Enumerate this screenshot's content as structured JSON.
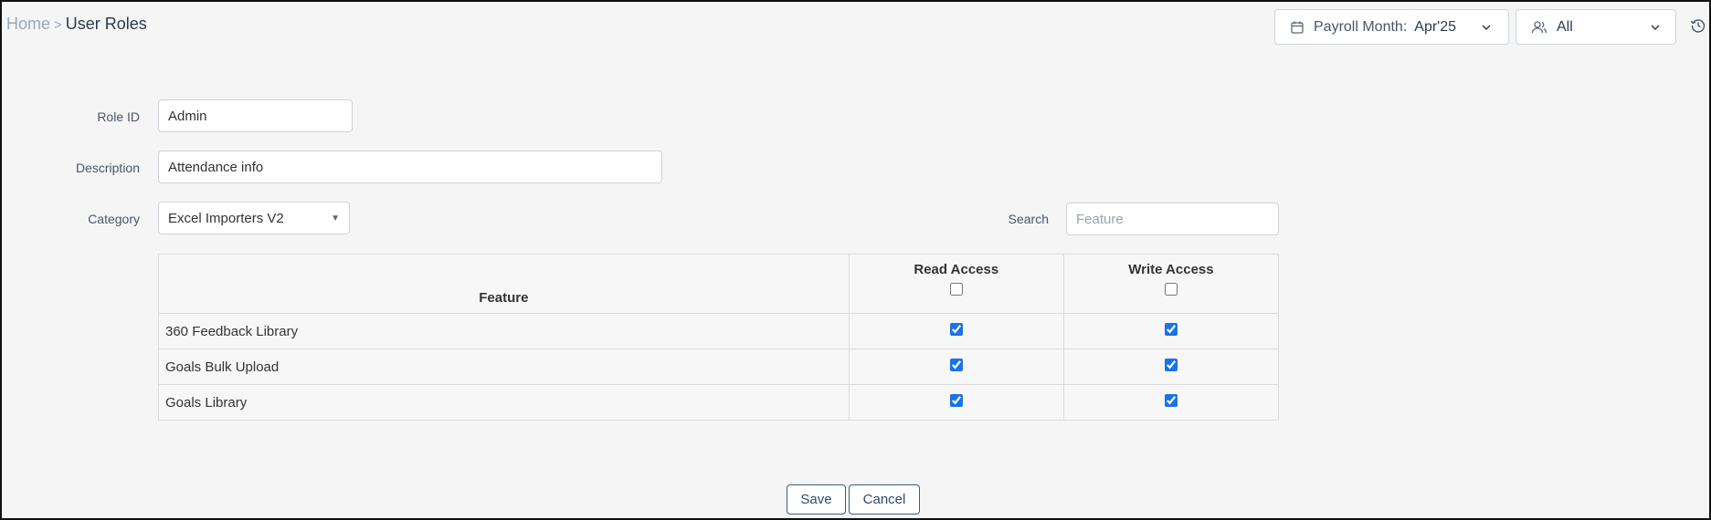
{
  "breadcrumb": {
    "home": "Home",
    "separator": ">",
    "current": "User Roles"
  },
  "header": {
    "payroll_label": "Payroll Month:",
    "payroll_value": "Apr'25",
    "people_value": "All"
  },
  "form": {
    "role_id_label": "Role ID",
    "role_id_value": "Admin",
    "description_label": "Description",
    "description_value": "Attendance info",
    "category_label": "Category",
    "category_value": "Excel Importers V2",
    "search_label": "Search",
    "search_placeholder": "Feature"
  },
  "table": {
    "headers": {
      "feature": "Feature",
      "read": "Read Access",
      "write": "Write Access"
    },
    "header_read_checked": false,
    "header_write_checked": false,
    "rows": [
      {
        "feature": "360 Feedback Library",
        "read": true,
        "write": true
      },
      {
        "feature": "Goals Bulk Upload",
        "read": true,
        "write": true
      },
      {
        "feature": "Goals Library",
        "read": true,
        "write": true
      }
    ]
  },
  "buttons": {
    "save": "Save",
    "cancel": "Cancel"
  },
  "icons": {
    "calendar": "calendar-icon",
    "people": "people-icon",
    "chevron": "chevron-down-icon",
    "history": "history-icon"
  },
  "colors": {
    "accent": "#2f4a70",
    "checkbox": "#1a73e8"
  }
}
